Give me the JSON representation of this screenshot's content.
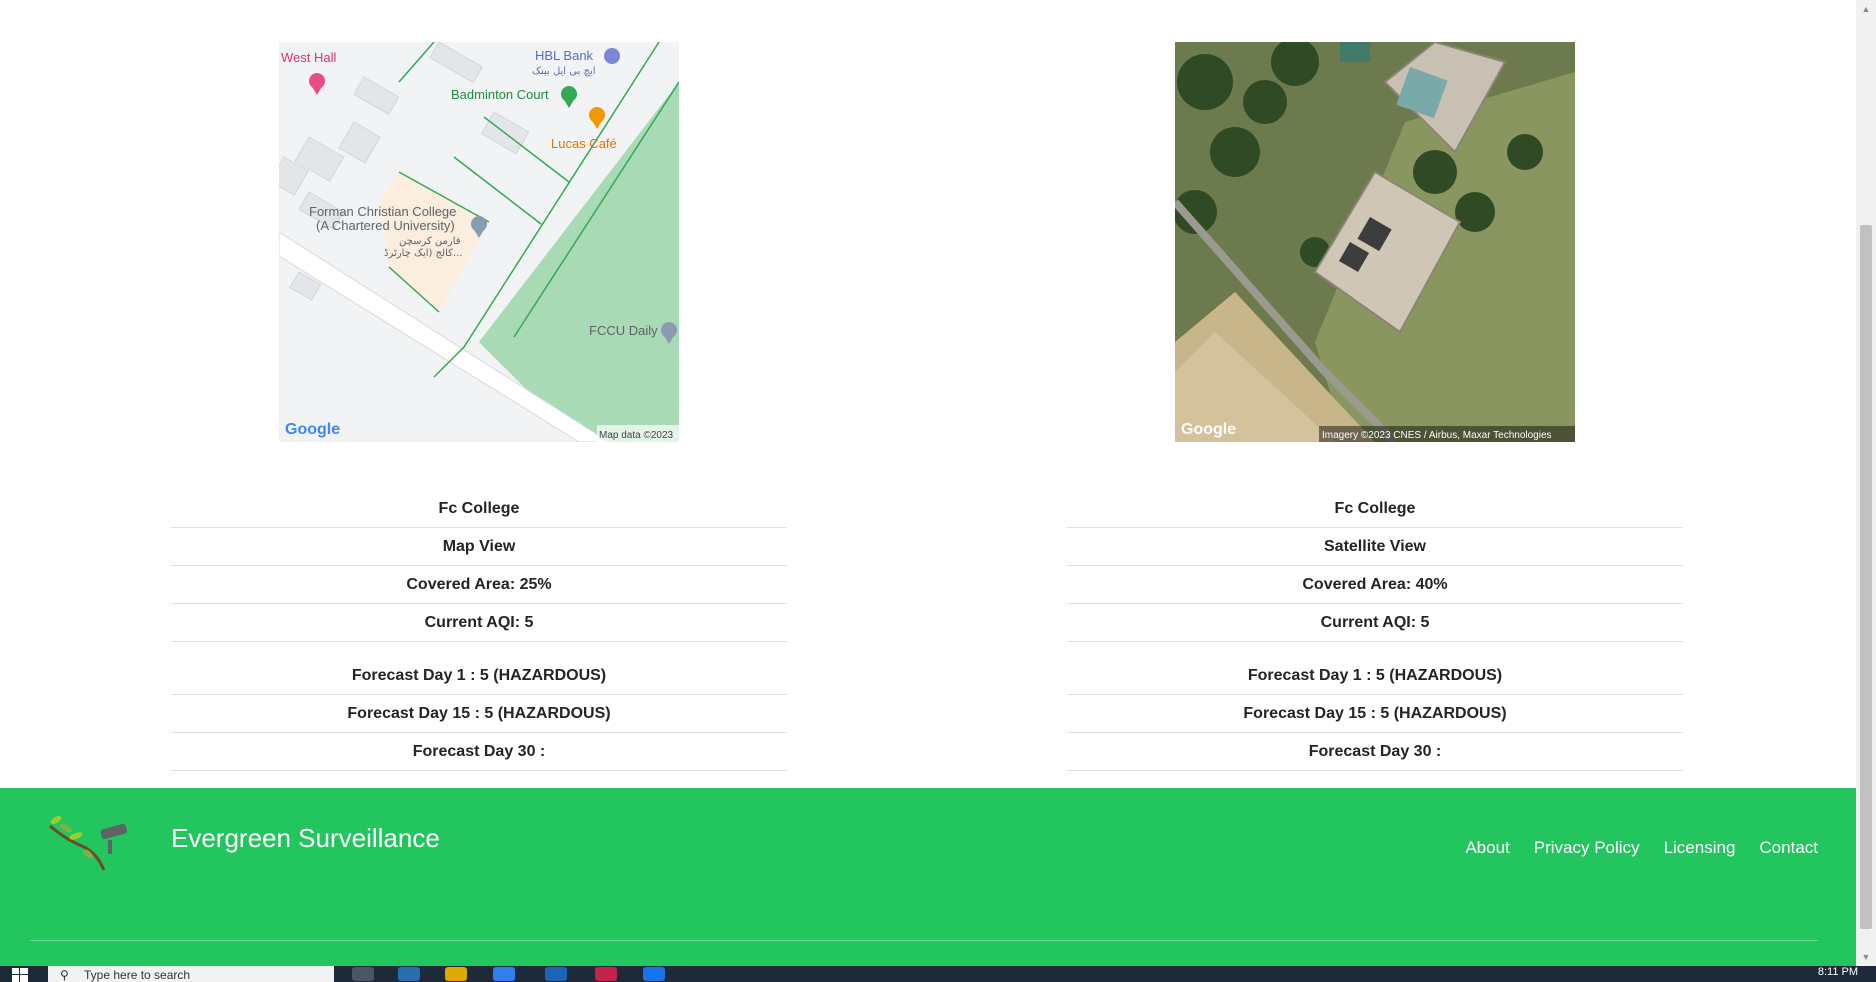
{
  "left_panel": {
    "map_labels": {
      "west_hall": "West Hall",
      "hbl_bank": "HBL Bank",
      "hbl_bank_urdu": "ایچ بی ایل بینک",
      "badminton_court": "Badminton Court",
      "lucas_cafe": "Lucas Café",
      "fcc_line1": "Forman Christian College",
      "fcc_line2": "(A Chartered University)",
      "fcc_urdu1": "فارمن کرسچن",
      "fcc_urdu2": "کالج (ایک چارٹرڈ...",
      "fccu_daily": "FCCU Daily",
      "google": "Google",
      "attribution": "Map data ©2023"
    },
    "rows": [
      "Fc College",
      "Map View",
      "Covered Area: 25%",
      "Current AQI: 5"
    ],
    "forecast": [
      "Forecast Day 1 : 5 (HAZARDOUS)",
      "Forecast Day 15 : 5 (HAZARDOUS)",
      "Forecast Day 30 :"
    ]
  },
  "right_panel": {
    "map_labels": {
      "google": "Google",
      "attribution": "Imagery ©2023 CNES / Airbus, Maxar Technologies"
    },
    "rows": [
      "Fc College",
      "Satellite View",
      "Covered Area: 40%",
      "Current AQI: 5"
    ],
    "forecast": [
      "Forecast Day 1 : 5 (HAZARDOUS)",
      "Forecast Day 15 : 5 (HAZARDOUS)",
      "Forecast Day 30 :"
    ]
  },
  "footer": {
    "brand": "Evergreen Surveillance",
    "links": [
      "About",
      "Privacy Policy",
      "Licensing",
      "Contact"
    ],
    "background": "#22c55e"
  },
  "taskbar": {
    "search_placeholder": "Type here to search",
    "clock": "8:11 PM"
  }
}
